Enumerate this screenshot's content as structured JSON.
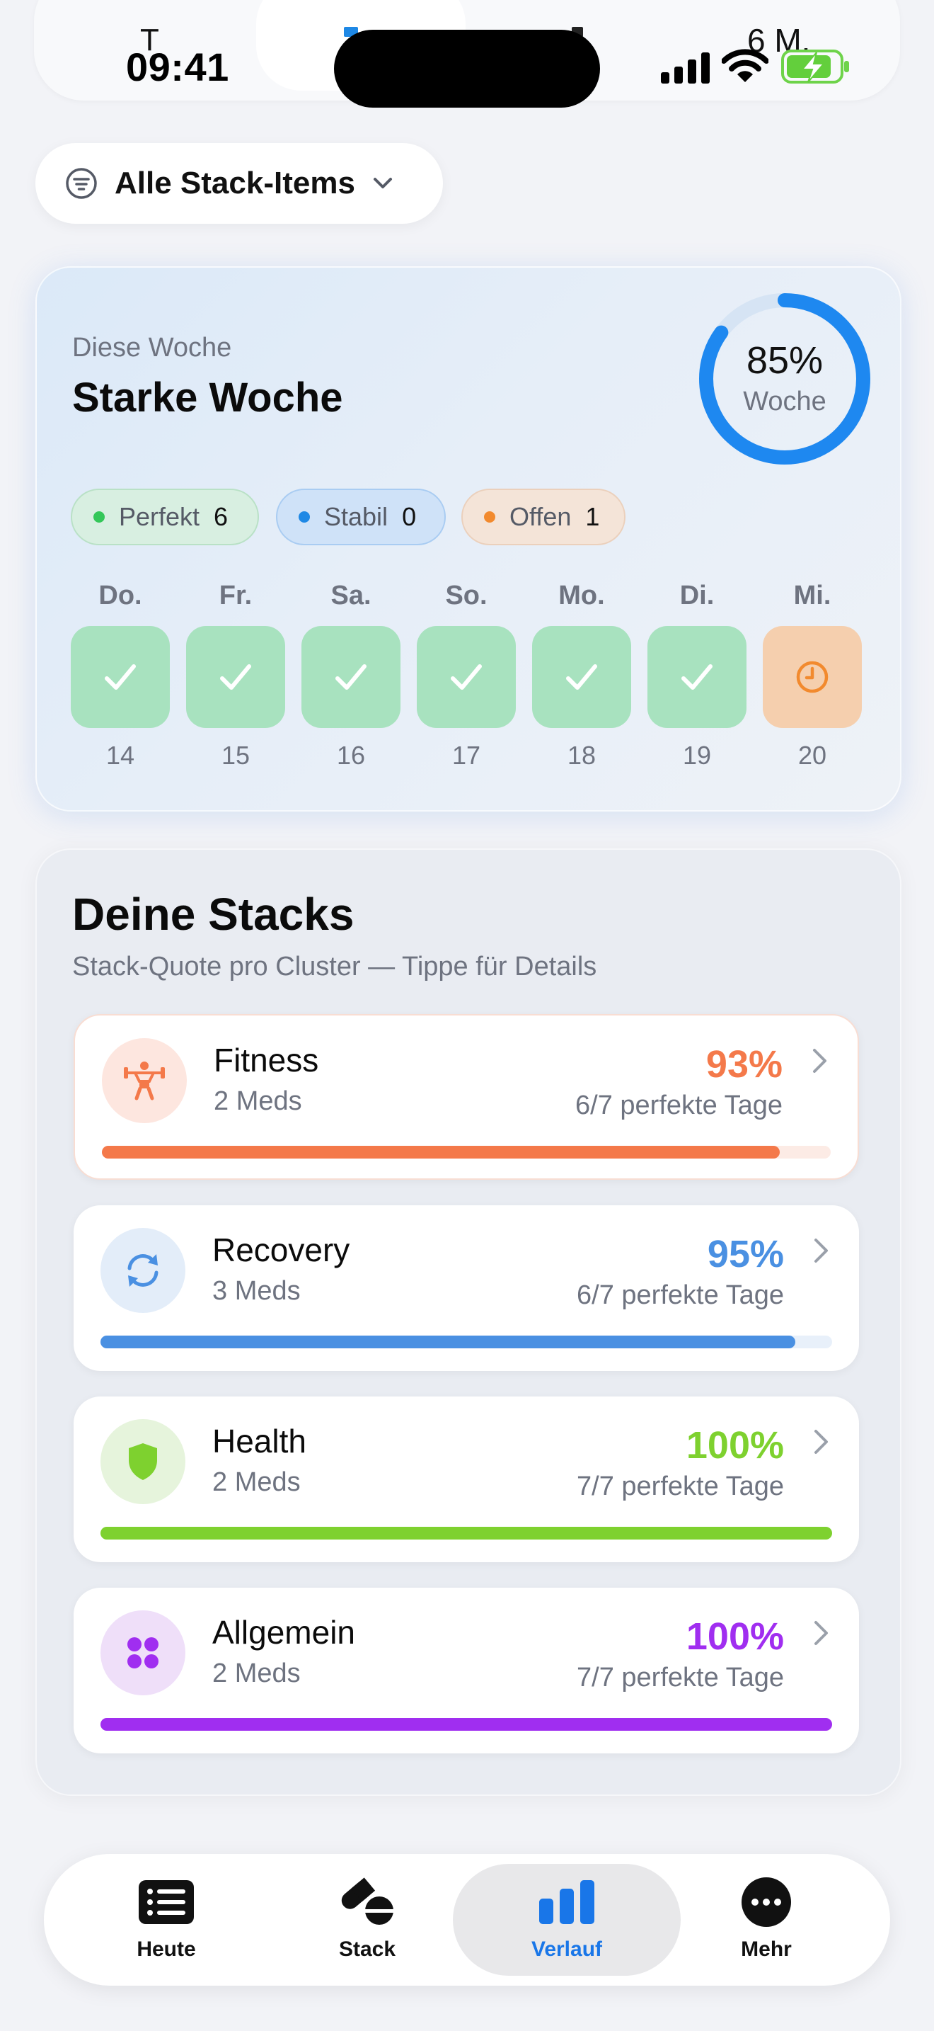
{
  "status_bar": {
    "time": "09:41",
    "ghost_left": "T",
    "ghost_right": "6 M."
  },
  "filter": {
    "label": "Alle Stack-Items",
    "icon": "filter-lines-icon"
  },
  "week": {
    "subtitle": "Diese Woche",
    "title": "Starke Woche",
    "ring_value": "85%",
    "ring_fraction": 0.85,
    "ring_label": "Woche",
    "chips": [
      {
        "name": "Perfekt",
        "count": "6",
        "color": "#34c759"
      },
      {
        "name": "Stabil",
        "count": "0",
        "color": "#1e88e5"
      },
      {
        "name": "Offen",
        "count": "1",
        "color": "#f28a2e"
      }
    ],
    "days": [
      {
        "label": "Do.",
        "num": "14",
        "status": "done"
      },
      {
        "label": "Fr.",
        "num": "15",
        "status": "done"
      },
      {
        "label": "Sa.",
        "num": "16",
        "status": "done"
      },
      {
        "label": "So.",
        "num": "17",
        "status": "done"
      },
      {
        "label": "Mo.",
        "num": "18",
        "status": "done"
      },
      {
        "label": "Di.",
        "num": "19",
        "status": "done"
      },
      {
        "label": "Mi.",
        "num": "20",
        "status": "open"
      }
    ]
  },
  "stacks": {
    "title": "Deine Stacks",
    "subtitle": "Stack-Quote pro Cluster — Tippe für Details",
    "items": [
      {
        "name": "Fitness",
        "meds": "2 Meds",
        "pct": "93%",
        "fraction": 0.93,
        "days": "6/7 perfekte Tage",
        "color": "#f4794a",
        "icon": "weightlifter-icon",
        "icon_bg": "#fde6df",
        "track": "#fcebe5"
      },
      {
        "name": "Recovery",
        "meds": "3 Meds",
        "pct": "95%",
        "fraction": 0.95,
        "days": "6/7 perfekte Tage",
        "color": "#4a90e2",
        "icon": "sync-arrows-icon",
        "icon_bg": "#e3edf9",
        "track": "#e8f0fa"
      },
      {
        "name": "Health",
        "meds": "2 Meds",
        "pct": "100%",
        "fraction": 1.0,
        "days": "7/7 perfekte Tage",
        "color": "#7ed12f",
        "icon": "shield-icon",
        "icon_bg": "#e6f4dc",
        "track": "#eaf5e0"
      },
      {
        "name": "Allgemein",
        "meds": "2 Meds",
        "pct": "100%",
        "fraction": 1.0,
        "days": "7/7 perfekte Tage",
        "color": "#a02ef0",
        "icon": "four-dots-icon",
        "icon_bg": "#efdff9",
        "track": "#f3e6fb"
      }
    ]
  },
  "tabs": [
    {
      "label": "Heute",
      "icon": "list-icon",
      "active": false
    },
    {
      "label": "Stack",
      "icon": "pills-icon",
      "active": false
    },
    {
      "label": "Verlauf",
      "icon": "bar-chart-icon",
      "active": true
    },
    {
      "label": "Mehr",
      "icon": "more-dots-icon",
      "active": false
    }
  ]
}
